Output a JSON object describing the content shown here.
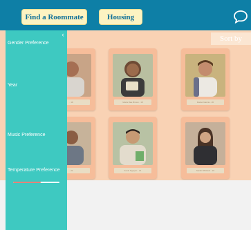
{
  "header": {
    "find_roommate_label": "Find a Roommate",
    "housing_label": "Housing",
    "chat_icon": "chat-bubble-icon"
  },
  "main": {
    "sort_label": "Sort by",
    "cards": [
      {
        "label": "Maria Rae Brown · 18"
      },
      {
        "label": "Daniel Garcia · 20"
      },
      {
        "label": "Kevin Nguyen · 21"
      },
      {
        "label": "Sarah Whitlock · 22"
      },
      {
        "label": "· 19"
      },
      {
        "label": "· 21"
      }
    ]
  },
  "sidebar": {
    "collapse_icon": "chevron-left-icon",
    "filters": [
      {
        "label": "Gender Preference"
      },
      {
        "label": "Year"
      },
      {
        "label": "Music Preference"
      },
      {
        "label": "Temperature Preference"
      }
    ],
    "temperature_level": 0.6
  },
  "colors": {
    "topbar": "#0e7fa6",
    "sidebar": "#3ec9c1",
    "nav_button": "#fdf3c2",
    "content_overlay": "#f9d2b4"
  }
}
